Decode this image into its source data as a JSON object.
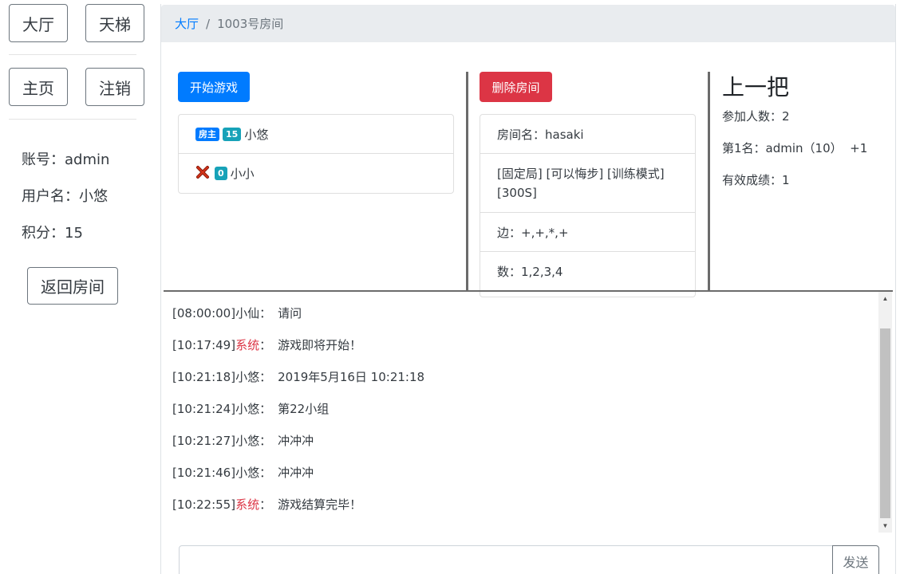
{
  "sidebar": {
    "nav": {
      "hall": "大厅",
      "ladder": "天梯",
      "home": "主页",
      "logout": "注销"
    },
    "info": {
      "account": "账号：admin",
      "username": "用户名：小悠",
      "score": "积分：15"
    },
    "back_button": "返回房间"
  },
  "breadcrumb": {
    "hall": "大厅",
    "separator": "/",
    "current": "1003号房间"
  },
  "players": {
    "start_button": "开始游戏",
    "list": [
      {
        "badges": [
          "房主",
          "15"
        ],
        "name": "小悠"
      },
      {
        "icon": "x-mark-icon",
        "badges": [
          "0"
        ],
        "name": "小小"
      }
    ]
  },
  "room": {
    "delete_button": "删除房间",
    "details": [
      "房间名：hasaki",
      "[固定局] [可以悔步] [训练模式] [300S]",
      "边：+,+,*,+",
      "数：1,2,3,4"
    ]
  },
  "last_game": {
    "title": "上一把",
    "participants": "参加人数：2",
    "rank1": "第1名：admin（10）  +1",
    "valid": "有效成绩：1"
  },
  "chat": {
    "messages": [
      {
        "time": "[08:00:00]",
        "sender": "小仙",
        "sep": "：",
        "text": "请问",
        "system": false
      },
      {
        "time": "[10:17:49]",
        "sender": "系统",
        "sep": "：",
        "text": "游戏即将开始！",
        "system": true
      },
      {
        "time": "[10:21:18]",
        "sender": "小悠",
        "sep": "：",
        "text": "2019年5月16日 10:21:18",
        "system": false
      },
      {
        "time": "[10:21:24]",
        "sender": "小悠",
        "sep": "：",
        "text": "第22小组",
        "system": false
      },
      {
        "time": "[10:21:27]",
        "sender": "小悠",
        "sep": "：",
        "text": "冲冲冲",
        "system": false
      },
      {
        "time": "[10:21:46]",
        "sender": "小悠",
        "sep": "：",
        "text": "冲冲冲",
        "system": false
      },
      {
        "time": "[10:22:55]",
        "sender": "系统",
        "sep": "：",
        "text": "游戏结算完毕！",
        "system": true
      }
    ],
    "send_label": "发送",
    "input_value": ""
  },
  "colors": {
    "primary": "#007bff",
    "danger": "#dc3545",
    "info": "#17a2b8",
    "breadcrumb_bg": "#e9ecef"
  }
}
